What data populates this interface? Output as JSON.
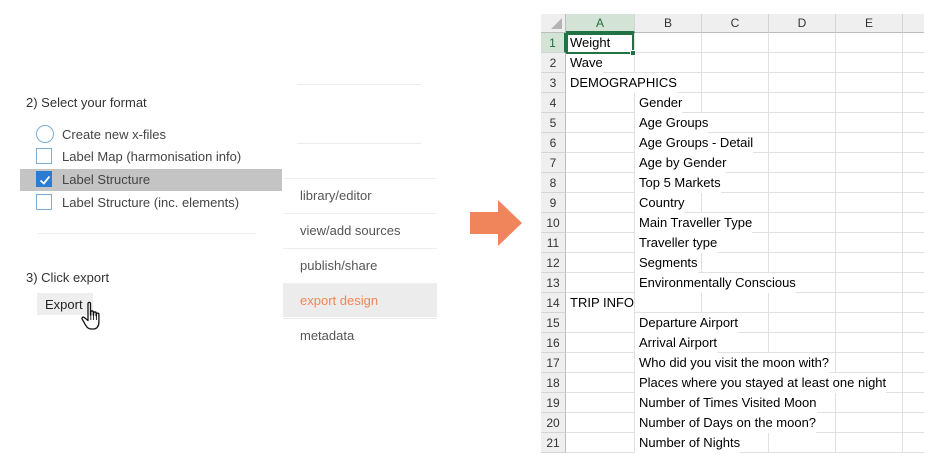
{
  "format_section": {
    "title": "2) Select your format",
    "options": [
      {
        "label": "Create new x-files",
        "control": "radio",
        "checked": false
      },
      {
        "label": "Label Map (harmonisation info)",
        "control": "checkbox",
        "checked": false
      },
      {
        "label": "Label Structure",
        "control": "checkbox",
        "checked": true
      },
      {
        "label": "Label Structure (inc. elements)",
        "control": "checkbox",
        "checked": false
      }
    ]
  },
  "export_section": {
    "title": "3) Click export",
    "button_label": "Export"
  },
  "nav_menu": {
    "items": [
      {
        "label": "library/editor",
        "active": false
      },
      {
        "label": "view/add sources",
        "active": false
      },
      {
        "label": "publish/share",
        "active": false
      },
      {
        "label": "export design",
        "active": true
      },
      {
        "label": "metadata",
        "active": false
      }
    ]
  },
  "colors": {
    "arrow": "#f0855b",
    "accent_text": "#f0855b",
    "checkbox_checked": "#2b7cd3",
    "excel_green": "#217346"
  },
  "spreadsheet": {
    "columns": [
      "A",
      "B",
      "C",
      "D",
      "E"
    ],
    "selected_cell": "A1",
    "rows": [
      {
        "num": "1",
        "a": "Weight",
        "b": ""
      },
      {
        "num": "2",
        "a": "Wave",
        "b": ""
      },
      {
        "num": "3",
        "a": "DEMOGRAPHICS",
        "b": ""
      },
      {
        "num": "4",
        "a": "",
        "b": "Gender"
      },
      {
        "num": "5",
        "a": "",
        "b": "Age Groups"
      },
      {
        "num": "6",
        "a": "",
        "b": "Age Groups - Detail"
      },
      {
        "num": "7",
        "a": "",
        "b": "Age by Gender"
      },
      {
        "num": "8",
        "a": "",
        "b": "Top 5 Markets"
      },
      {
        "num": "9",
        "a": "",
        "b": "Country"
      },
      {
        "num": "10",
        "a": "",
        "b": "Main Traveller Type"
      },
      {
        "num": "11",
        "a": "",
        "b": "Traveller type"
      },
      {
        "num": "12",
        "a": "",
        "b": "Segments"
      },
      {
        "num": "13",
        "a": "",
        "b": "Environmentally Conscious"
      },
      {
        "num": "14",
        "a": "TRIP INFO",
        "b": ""
      },
      {
        "num": "15",
        "a": "",
        "b": "Departure Airport"
      },
      {
        "num": "16",
        "a": "",
        "b": "Arrival Airport"
      },
      {
        "num": "17",
        "a": "",
        "b": "Who did you visit the moon with?"
      },
      {
        "num": "18",
        "a": "",
        "b": "Places where you stayed at least one night"
      },
      {
        "num": "19",
        "a": "",
        "b": "Number of Times Visited Moon"
      },
      {
        "num": "20",
        "a": "",
        "b": "Number of Days on the moon?"
      },
      {
        "num": "21",
        "a": "",
        "b": "Number of Nights"
      }
    ]
  },
  "icons": {
    "cursor": "hand-pointer-icon",
    "arrow": "right-arrow-icon",
    "check": "checkmark-icon"
  }
}
